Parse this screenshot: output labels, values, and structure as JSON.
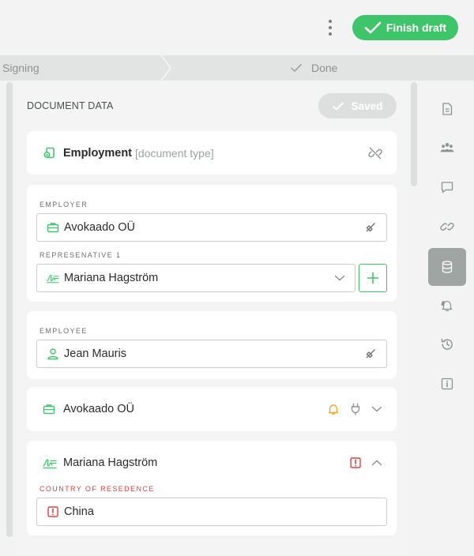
{
  "toolbar": {
    "finish_label": "Finish draft"
  },
  "steps": {
    "signing": "Signing",
    "done": "Done"
  },
  "panel": {
    "title": "DOCUMENT DATA",
    "saved_label": "Saved"
  },
  "document_type_card": {
    "title": "Employment",
    "subtitle": "[document type]"
  },
  "employer_card": {
    "employer_label": "EMPLOYER",
    "employer_value": "Avokaado OÜ",
    "representative_label": "REPRESENATIVE 1",
    "representative_value": "Mariana Hagström"
  },
  "employee_card": {
    "employee_label": "EMPLOYEE",
    "employee_value": "Jean Mauris"
  },
  "company_card": {
    "title": "Avokaado OÜ"
  },
  "person_card": {
    "title": "Mariana Hagström",
    "country_label": "COUNTRY OF RESEDENCE",
    "country_value": "China"
  },
  "sidebar": {
    "items": [
      "document-icon",
      "people-icon",
      "comment-icon",
      "link-icon",
      "database-icon",
      "bell-icon",
      "history-icon",
      "info-icon"
    ],
    "active": "database-icon"
  },
  "colors": {
    "accent_green": "#3ec469",
    "error_red": "#e0413f",
    "warning_orange": "#f4a92b",
    "active_sidebar": "#9fa5a3"
  }
}
